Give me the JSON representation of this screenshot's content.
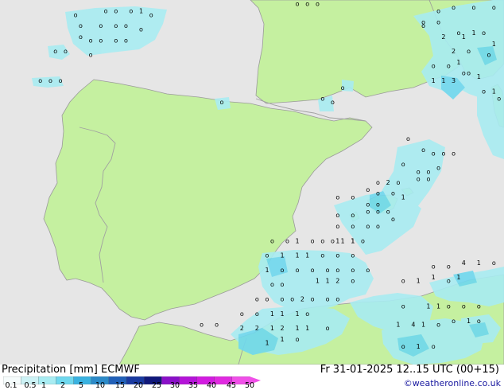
{
  "title": {
    "left": "Precipitation [mm] ECMWF",
    "right": "Fr 31-01-2025 12..15 UTC (00+15)"
  },
  "credit": "©weatheronline.co.uk",
  "colors": {
    "sea": "#e6e6e6",
    "land": "#c5f0a0",
    "precip_light": "#a8ecf2",
    "precip_mid": "#6fd8ee",
    "precip_heavy": "#3ab2e0",
    "coast": "#9a9a9a",
    "border": "#a0a0a0"
  },
  "legend": {
    "labels": [
      "0.1",
      "0.5",
      "1",
      "2",
      "5",
      "10",
      "15",
      "20",
      "25",
      "30",
      "35",
      "40",
      "45",
      "50"
    ],
    "colors": [
      "#f6fcfc",
      "#cdf2f5",
      "#a8ecf2",
      "#6fd8ee",
      "#3ab2e0",
      "#2c8ac8",
      "#2160b8",
      "#1a3aa0",
      "#10187a",
      "#8a10c8",
      "#b414d8",
      "#d21ce0",
      "#e02ae0",
      "#f050e8"
    ]
  },
  "map_labels": [
    [
      "o",
      0.15,
      0.04
    ],
    [
      "o",
      0.21,
      0.03
    ],
    [
      "o",
      0.23,
      0.03
    ],
    [
      "o",
      0.26,
      0.03
    ],
    [
      "1",
      0.28,
      0.03
    ],
    [
      "o",
      0.3,
      0.04
    ],
    [
      "o",
      0.16,
      0.07
    ],
    [
      "o",
      0.2,
      0.07
    ],
    [
      "o",
      0.23,
      0.07
    ],
    [
      "o",
      0.25,
      0.07
    ],
    [
      "o",
      0.28,
      0.08
    ],
    [
      "o",
      0.16,
      0.1
    ],
    [
      "o",
      0.18,
      0.11
    ],
    [
      "o",
      0.2,
      0.11
    ],
    [
      "o",
      0.23,
      0.11
    ],
    [
      "o",
      0.25,
      0.11
    ],
    [
      "o",
      0.11,
      0.14
    ],
    [
      "o",
      0.13,
      0.14
    ],
    [
      "o",
      0.18,
      0.15
    ],
    [
      "o",
      0.08,
      0.22
    ],
    [
      "o",
      0.1,
      0.22
    ],
    [
      "o",
      0.12,
      0.22
    ],
    [
      "o",
      0.44,
      0.28
    ],
    [
      "o",
      0.64,
      0.27
    ],
    [
      "o",
      0.66,
      0.28
    ],
    [
      "o",
      0.68,
      0.24
    ],
    [
      "o",
      0.59,
      0.01
    ],
    [
      "o",
      0.61,
      0.01
    ],
    [
      "o",
      0.63,
      0.01
    ],
    [
      "o",
      0.84,
      0.06
    ],
    [
      "o",
      0.87,
      0.03
    ],
    [
      "o",
      0.9,
      0.02
    ],
    [
      "o",
      0.94,
      0.02
    ],
    [
      "o",
      0.98,
      0.02
    ],
    [
      "o",
      0.84,
      0.07
    ],
    [
      "o",
      0.87,
      0.06
    ],
    [
      "2",
      0.88,
      0.1
    ],
    [
      "o",
      0.91,
      0.09
    ],
    [
      "1",
      0.94,
      0.09
    ],
    [
      "o",
      0.96,
      0.09
    ],
    [
      "1",
      0.98,
      0.12
    ],
    [
      "1",
      0.92,
      0.1
    ],
    [
      "2",
      0.9,
      0.14
    ],
    [
      "o",
      0.93,
      0.14
    ],
    [
      "o",
      0.97,
      0.15
    ],
    [
      "o",
      0.86,
      0.18
    ],
    [
      "o",
      0.89,
      0.18
    ],
    [
      "1",
      0.91,
      0.17
    ],
    [
      "o",
      0.93,
      0.2
    ],
    [
      "1",
      0.95,
      0.21
    ],
    [
      "1",
      0.86,
      0.22
    ],
    [
      "1",
      0.88,
      0.22
    ],
    [
      "3",
      0.9,
      0.22
    ],
    [
      "o",
      0.92,
      0.2
    ],
    [
      "o",
      0.96,
      0.25
    ],
    [
      "1",
      0.98,
      0.25
    ],
    [
      "o",
      0.99,
      0.27
    ],
    [
      "o",
      0.81,
      0.38
    ],
    [
      "o",
      0.84,
      0.41
    ],
    [
      "o",
      0.86,
      0.42
    ],
    [
      "o",
      0.88,
      0.42
    ],
    [
      "o",
      0.9,
      0.42
    ],
    [
      "o",
      0.8,
      0.45
    ],
    [
      "o",
      0.83,
      0.47
    ],
    [
      "o",
      0.85,
      0.47
    ],
    [
      "o",
      0.87,
      0.46
    ],
    [
      "o",
      0.75,
      0.5
    ],
    [
      "2",
      0.77,
      0.5
    ],
    [
      "o",
      0.79,
      0.5
    ],
    [
      "o",
      0.83,
      0.49
    ],
    [
      "o",
      0.85,
      0.49
    ],
    [
      "o",
      0.73,
      0.52
    ],
    [
      "o",
      0.75,
      0.53
    ],
    [
      "o",
      0.78,
      0.53
    ],
    [
      "1",
      0.8,
      0.54
    ],
    [
      "o",
      0.67,
      0.54
    ],
    [
      "o",
      0.7,
      0.54
    ],
    [
      "o",
      0.73,
      0.56
    ],
    [
      "o",
      0.75,
      0.56
    ],
    [
      "o",
      0.67,
      0.59
    ],
    [
      "o",
      0.7,
      0.59
    ],
    [
      "o",
      0.73,
      0.58
    ],
    [
      "o",
      0.75,
      0.58
    ],
    [
      "o",
      0.77,
      0.58
    ],
    [
      "o",
      0.67,
      0.62
    ],
    [
      "o",
      0.7,
      0.62
    ],
    [
      "o",
      0.73,
      0.62
    ],
    [
      "o",
      0.75,
      0.62
    ],
    [
      "o",
      0.78,
      0.6
    ],
    [
      "o",
      0.66,
      0.66
    ],
    [
      "1",
      0.68,
      0.66
    ],
    [
      "1",
      0.7,
      0.66
    ],
    [
      "o",
      0.72,
      0.66
    ],
    [
      "o",
      0.54,
      0.66
    ],
    [
      "o",
      0.57,
      0.66
    ],
    [
      "1",
      0.59,
      0.66
    ],
    [
      "o",
      0.62,
      0.66
    ],
    [
      "o",
      0.64,
      0.66
    ],
    [
      "1",
      0.67,
      0.66
    ],
    [
      "1",
      0.7,
      0.66
    ],
    [
      "o",
      0.53,
      0.7
    ],
    [
      "1",
      0.56,
      0.7
    ],
    [
      "1",
      0.59,
      0.7
    ],
    [
      "1",
      0.61,
      0.7
    ],
    [
      "o",
      0.64,
      0.7
    ],
    [
      "o",
      0.67,
      0.7
    ],
    [
      "o",
      0.7,
      0.7
    ],
    [
      "1",
      0.53,
      0.74
    ],
    [
      "o",
      0.56,
      0.74
    ],
    [
      "o",
      0.59,
      0.74
    ],
    [
      "o",
      0.62,
      0.74
    ],
    [
      "o",
      0.65,
      0.74
    ],
    [
      "o",
      0.67,
      0.74
    ],
    [
      "o",
      0.7,
      0.74
    ],
    [
      "o",
      0.73,
      0.74
    ],
    [
      "o",
      0.54,
      0.78
    ],
    [
      "o",
      0.56,
      0.78
    ],
    [
      "1",
      0.63,
      0.77
    ],
    [
      "1",
      0.65,
      0.77
    ],
    [
      "2",
      0.67,
      0.77
    ],
    [
      "o",
      0.7,
      0.77
    ],
    [
      "o",
      0.51,
      0.82
    ],
    [
      "o",
      0.53,
      0.82
    ],
    [
      "o",
      0.56,
      0.82
    ],
    [
      "o",
      0.58,
      0.82
    ],
    [
      "2",
      0.6,
      0.82
    ],
    [
      "o",
      0.62,
      0.82
    ],
    [
      "o",
      0.65,
      0.82
    ],
    [
      "o",
      0.67,
      0.82
    ],
    [
      "o",
      0.48,
      0.86
    ],
    [
      "o",
      0.51,
      0.86
    ],
    [
      "1",
      0.54,
      0.86
    ],
    [
      "1",
      0.56,
      0.86
    ],
    [
      "1",
      0.59,
      0.86
    ],
    [
      "o",
      0.61,
      0.86
    ],
    [
      "o",
      0.4,
      0.89
    ],
    [
      "o",
      0.43,
      0.89
    ],
    [
      "2",
      0.48,
      0.9
    ],
    [
      "2",
      0.51,
      0.9
    ],
    [
      "1",
      0.54,
      0.9
    ],
    [
      "2",
      0.56,
      0.9
    ],
    [
      "1",
      0.59,
      0.9
    ],
    [
      "1",
      0.61,
      0.9
    ],
    [
      "o",
      0.65,
      0.9
    ],
    [
      "1",
      0.53,
      0.94
    ],
    [
      "1",
      0.56,
      0.93
    ],
    [
      "o",
      0.59,
      0.93
    ],
    [
      "o",
      0.8,
      0.77
    ],
    [
      "1",
      0.83,
      0.77
    ],
    [
      "1",
      0.86,
      0.76
    ],
    [
      "o",
      0.89,
      0.77
    ],
    [
      "1",
      0.91,
      0.76
    ],
    [
      "4",
      0.92,
      0.72
    ],
    [
      "1",
      0.95,
      0.72
    ],
    [
      "o",
      0.98,
      0.72
    ],
    [
      "o",
      0.89,
      0.73
    ],
    [
      "o",
      0.86,
      0.73
    ],
    [
      "o",
      0.8,
      0.84
    ],
    [
      "1",
      0.85,
      0.84
    ],
    [
      "1",
      0.87,
      0.84
    ],
    [
      "o",
      0.89,
      0.84
    ],
    [
      "o",
      0.92,
      0.84
    ],
    [
      "o",
      0.95,
      0.84
    ],
    [
      "1",
      0.79,
      0.89
    ],
    [
      "4",
      0.82,
      0.89
    ],
    [
      "1",
      0.84,
      0.89
    ],
    [
      "o",
      0.87,
      0.89
    ],
    [
      "o",
      0.9,
      0.88
    ],
    [
      "1",
      0.93,
      0.88
    ],
    [
      "o",
      0.95,
      0.88
    ],
    [
      "o",
      0.8,
      0.95
    ],
    [
      "1",
      0.83,
      0.95
    ],
    [
      "o",
      0.86,
      0.95
    ]
  ]
}
